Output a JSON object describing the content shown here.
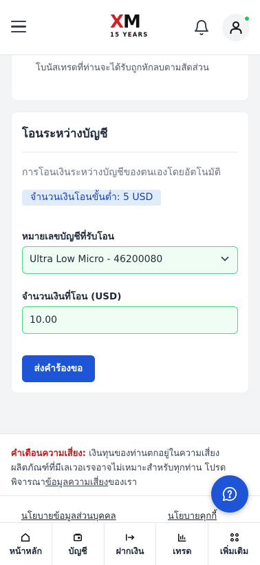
{
  "header": {
    "logo_text": "XM",
    "logo_subtitle": "15 YEARS",
    "icons": {
      "menu": "hamburger-menu-icon",
      "notifications": "bell-icon",
      "profile": "user-icon"
    }
  },
  "previous_card": {
    "faded_text": "โบนัสเทรดที่ท่านจะได้รับถูกหักลบตามสัดส่วน",
    "visible_text": "โบนัสเทรดที่ท่านจะได้รับถูกหักลบตามสัดส่วน"
  },
  "transfer": {
    "title": "โอนระหว่างบัญชี",
    "description": "การโอนเงินระหว่างบัญชีของตนเองโดยอัตโนมัติ",
    "min_amount": "จำนวนเงินโอนขั้นต่ำ: 5 USD",
    "account_label": "หมายเลขบัญชีที่รับโอน",
    "account_value": "Ultra Low Micro - 46200080",
    "amount_label": "จำนวนเงินที่โอน (USD)",
    "amount_value": "10.00",
    "submit_label": "ส่งคำร้องขอ"
  },
  "risk": {
    "warning_label": "คำเตือนความเสี่ยง:",
    "text_1": " เงินทุนของท่านตกอยู่ในความเสี่ยง ผลิตภัณฑ์ที่มีเลเวอเรจอาจไม่เหมาะสำหรับทุกท่าน โปรดพิจารณา",
    "link": "ข้อมูลความเสี่ยง",
    "text_2": "ของเรา"
  },
  "footer_links": {
    "privacy": "นโยบายข้อมูลส่วนบุคคล",
    "cookies": "นโยบายคุกกี้"
  },
  "bottom_nav": [
    {
      "label": "หน้าหลัก",
      "icon": "home-icon"
    },
    {
      "label": "บัญชี",
      "icon": "wallet-icon"
    },
    {
      "label": "ฝากเงิน",
      "icon": "deposit-arrow-icon"
    },
    {
      "label": "เทรด",
      "icon": "chart-icon"
    },
    {
      "label": "เพิ่มเติม",
      "icon": "grid-more-icon"
    }
  ],
  "colors": {
    "primary": "#1d55d6",
    "success_border": "#4ade80",
    "warning": "#b91c1c",
    "brand_red": "#d51f26"
  }
}
